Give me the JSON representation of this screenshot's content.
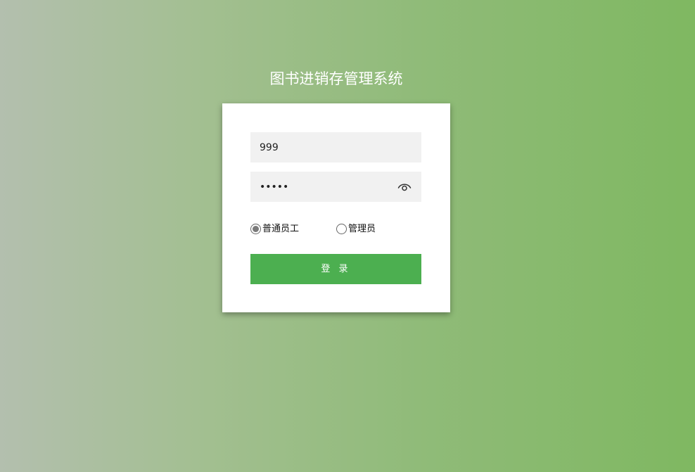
{
  "app": {
    "title": "图书进销存管理系统"
  },
  "login_form": {
    "username": {
      "value": "999"
    },
    "password": {
      "value": "•••••"
    },
    "roles": [
      {
        "label": "普通员工",
        "selected": true
      },
      {
        "label": "管理员",
        "selected": false
      }
    ],
    "submit_label": "登 录"
  },
  "colors": {
    "accent": "#4caf50",
    "background_left": "#b3bfae",
    "background_right": "#7fb861",
    "field_bg": "#f1f1f1"
  },
  "icons": {
    "password_toggle": "eye-icon"
  }
}
